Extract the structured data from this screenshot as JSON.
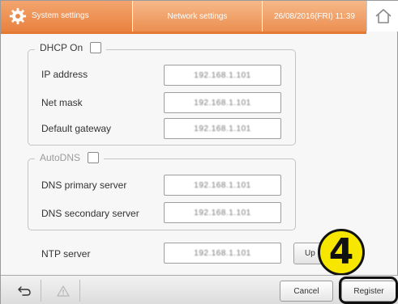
{
  "header": {
    "section_title": "System settings",
    "page_title": "Network settings",
    "datetime": "26/08/2016(FRI) 11:39",
    "icon": "gear-icon",
    "home_icon": "home-icon"
  },
  "dhcp": {
    "legend": "DHCP On",
    "checked": false,
    "fields": [
      {
        "label": "IP address",
        "value": "192.168.1.101"
      },
      {
        "label": "Net mask",
        "value": "192.168.1.101"
      },
      {
        "label": "Default gateway",
        "value": "192.168.1.101"
      }
    ]
  },
  "autodns": {
    "legend": "AutoDNS",
    "checked": false,
    "disabled": true,
    "fields": [
      {
        "label": "DNS primary server",
        "value": "192.168.1.101"
      },
      {
        "label": "DNS secondary server",
        "value": "192.168.1.101"
      }
    ]
  },
  "ntp": {
    "label": "NTP server",
    "value": "192.168.1.101",
    "update_label": "Up"
  },
  "callout": {
    "number": "4"
  },
  "footer": {
    "back_icon": "back-arrow-icon",
    "warning_icon": "warning-icon",
    "cancel_label": "Cancel",
    "register_label": "Register"
  },
  "colors": {
    "header_orange": "#e9813f",
    "callout_yellow": "#f6e600"
  }
}
